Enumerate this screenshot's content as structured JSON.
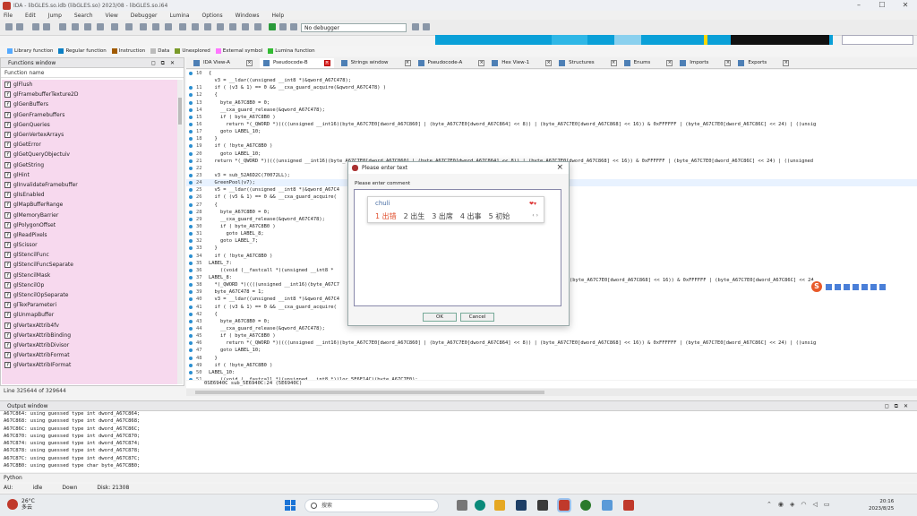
{
  "window": {
    "title": "IDA - libGLES.so.idb (libGLES.so) 2023/08 - libGLES.so.i64"
  },
  "menu": [
    "File",
    "Edit",
    "Jump",
    "Search",
    "View",
    "Debugger",
    "Lumina",
    "Options",
    "Windows",
    "Help"
  ],
  "toolbar": {
    "debugger": "No debugger"
  },
  "legend": [
    {
      "label": "Library function",
      "color": "#55aaff"
    },
    {
      "label": "Regular function",
      "color": "#0a7fc4"
    },
    {
      "label": "Instruction",
      "color": "#a05a00"
    },
    {
      "label": "Data",
      "color": "#bbbbbb"
    },
    {
      "label": "Unexplored",
      "color": "#7a9a2a"
    },
    {
      "label": "External symbol",
      "color": "#ff77ff"
    },
    {
      "label": "Lumina function",
      "color": "#33bb33"
    }
  ],
  "functions_panel": {
    "title": "Functions window",
    "column": "Function name",
    "items": [
      "glFlush",
      "glFramebufferTexture2D",
      "glGenBuffers",
      "glGenFramebuffers",
      "glGenQueries",
      "glGenVertexArrays",
      "glGetError",
      "glGetQueryObjectuiv",
      "glGetString",
      "glHint",
      "glInvalidateFramebuffer",
      "glIsEnabled",
      "glMapBufferRange",
      "glMemoryBarrier",
      "glPolygonOffset",
      "glReadPixels",
      "glScissor",
      "glStencilFunc",
      "glStencilFuncSeparate",
      "glStencilMask",
      "glStencilOp",
      "glStencilOpSeparate",
      "glTexParameteri",
      "glUnmapBuffer",
      "glVertexAttrib4fv",
      "glVertexAttribBinding",
      "glVertexAttribDivisor",
      "glVertexAttribFormat",
      "glVertexAttribIFormat"
    ],
    "line_status": "Line 325644 of 329644"
  },
  "tabs": [
    {
      "label": "IDA View-A",
      "close": false
    },
    {
      "label": "Pseudocode-B",
      "close": true,
      "active": true
    },
    {
      "label": "Strings window",
      "close": false
    },
    {
      "label": "Pseudocode-A",
      "close": false
    },
    {
      "label": "Hex View-1",
      "close": false
    },
    {
      "label": "Structures",
      "close": false
    },
    {
      "label": "Enums",
      "close": false
    },
    {
      "label": "Imports",
      "close": false
    },
    {
      "label": "Exports",
      "close": false
    }
  ],
  "code": [
    {
      "n": "10",
      "t": "{"
    },
    {
      "n": "",
      "t": "  v3 = __ldar((unsigned __int8 *)&qword_A67C478);"
    },
    {
      "n": "11",
      "t": "  if ( (v3 & 1) == 0 && __cxa_guard_acquire(&qword_A67C478) )"
    },
    {
      "n": "12",
      "t": "  {"
    },
    {
      "n": "13",
      "t": "    byte_A67C8B0 = 0;"
    },
    {
      "n": "14",
      "t": "    __cxa_guard_release(&qword_A67C478);"
    },
    {
      "n": "15",
      "t": "    if ( byte_A67C8B0 )"
    },
    {
      "n": "16",
      "t": "      return *(_QWORD *)((((unsigned __int16)(byte_A67C7E0[dword_A67C860] | (byte_A67C7E0[dword_A67C864] << 8)) | (byte_A67C7E0[dword_A67C868] << 16)) & 0xFFFFFF | (byte_A67C7E0[dword_A67C86C] << 24) | ((unsig"
    },
    {
      "n": "17",
      "t": "    goto LABEL_10;"
    },
    {
      "n": "18",
      "t": "  }"
    },
    {
      "n": "19",
      "t": "  if ( !byte_A67C8B0 )"
    },
    {
      "n": "20",
      "t": "    goto LABEL_10;"
    },
    {
      "n": "21",
      "t": "  return *(_QWORD *)((((unsigned __int16)(byte_A67C7E0[dword_A67C860] | (byte_A67C7E0[dword_A67C864] << 8)) | (byte_A67C7E0[dword_A67C868] << 16)) & 0xFFFFFF | (byte_A67C7E0[dword_A67C86C] << 24) | ((unsigned"
    },
    {
      "n": "22",
      "t": ""
    },
    {
      "n": "23",
      "t": "  v3 = sub_52A6D2C(70072LL);"
    },
    {
      "n": "24",
      "t": "  GreenPool(v7);",
      "hl": true
    },
    {
      "n": "25",
      "t": "  v5 = __ldar((unsigned __int8 *)&qword_A67C4"
    },
    {
      "n": "26",
      "t": "  if ( (v5 & 1) == 0 && __cxa_guard_acquire("
    },
    {
      "n": "27",
      "t": "  {"
    },
    {
      "n": "28",
      "t": "    byte_A67C8B0 = 0;"
    },
    {
      "n": "29",
      "t": "    __cxa_guard_release(&qword_A67C478);"
    },
    {
      "n": "30",
      "t": "    if ( byte_A67C8B0 )"
    },
    {
      "n": "31",
      "t": "      goto LABEL_8;"
    },
    {
      "n": "32",
      "t": "    goto LABEL_7;"
    },
    {
      "n": "33",
      "t": "  }"
    },
    {
      "n": "34",
      "t": "  if ( !byte_A67C8B0 )"
    },
    {
      "n": "35",
      "t": "LABEL_7:"
    },
    {
      "n": "36",
      "t": "    ((void (__fastcall *)(unsigned __int8 *"
    },
    {
      "n": "37",
      "t": "LABEL_8:"
    },
    {
      "n": "38",
      "t": "  *(_QWORD *)((((unsigned __int16)(byte_A67C7"
    },
    {
      "n": "39",
      "t": "  byte_A67C478 = 1;"
    },
    {
      "n": "40",
      "t": "  v3 = __ldar((unsigned __int8 *)&qword_A67C4"
    },
    {
      "n": "41",
      "t": "  if ( (v3 & 1) == 0 && __cxa_guard_acquire("
    },
    {
      "n": "42",
      "t": "  {"
    },
    {
      "n": "43",
      "t": "    byte_A67C8B0 = 0;"
    },
    {
      "n": "44",
      "t": "    __cxa_guard_release(&qword_A67C478);"
    },
    {
      "n": "45",
      "t": "    if ( byte_A67C8B0 )"
    },
    {
      "n": "46",
      "t": "      return *(_QWORD *)((((unsigned __int16)(byte_A67C7E0[dword_A67C860] | (byte_A67C7E0[dword_A67C864] << 8)) | (byte_A67C7E0[dword_A67C868] << 16)) & 0xFFFFFF | (byte_A67C7E0[dword_A67C86C] << 24) | ((unsig"
    },
    {
      "n": "47",
      "t": "    goto LABEL_10;"
    },
    {
      "n": "48",
      "t": "  }"
    },
    {
      "n": "49",
      "t": "  if ( !byte_A67C8B0 )"
    },
    {
      "n": "50",
      "t": "LABEL_10:"
    },
    {
      "n": "51",
      "t": "    ((void (__fastcall *)(unsigned __int8 *))loc_5E6E14C)(byte_A67C7E0);"
    }
  ],
  "code_right_fragment": "(byte_A67C7E0[dword_A67C868] << 16)) & 0xFFFFFF | (byte_A67C7E0[dword_A67C86C] << 24",
  "address_bar": "0SE6940C sub_5E6940C:24 (5E6940C)",
  "output": {
    "title": "Output window",
    "lines": [
      "A67C864: using guessed type int dword_A67C864;",
      "A67C868: using guessed type int dword_A67C868;",
      "A67C86C: using guessed type int dword_A67C86C;",
      "A67C870: using guessed type int dword_A67C870;",
      "A67C874: using guessed type int dword_A67C874;",
      "A67C878: using guessed type int dword_A67C878;",
      "A67C87C: using guessed type int dword_A67C87C;",
      "A67C8B0: using guessed type char byte_A67C8B0;"
    ]
  },
  "python_label": "Python",
  "status": [
    "AU:",
    "idle",
    "Down",
    "Disk: 21308"
  ],
  "dialog": {
    "title": "Please enter text",
    "label": "Please enter comment",
    "ok": "OK",
    "cancel": "Cancel"
  },
  "ime": {
    "composition": "chuli",
    "candidates": [
      "1 出错",
      "2 出生",
      "3 出席",
      "4 出事",
      "5 初始"
    ],
    "pager": "‹ ›"
  },
  "taskbar": {
    "weather_temp": "26°C",
    "weather_text": "多云",
    "search": "搜索",
    "time": "20:16",
    "date": "2023/8/25"
  }
}
